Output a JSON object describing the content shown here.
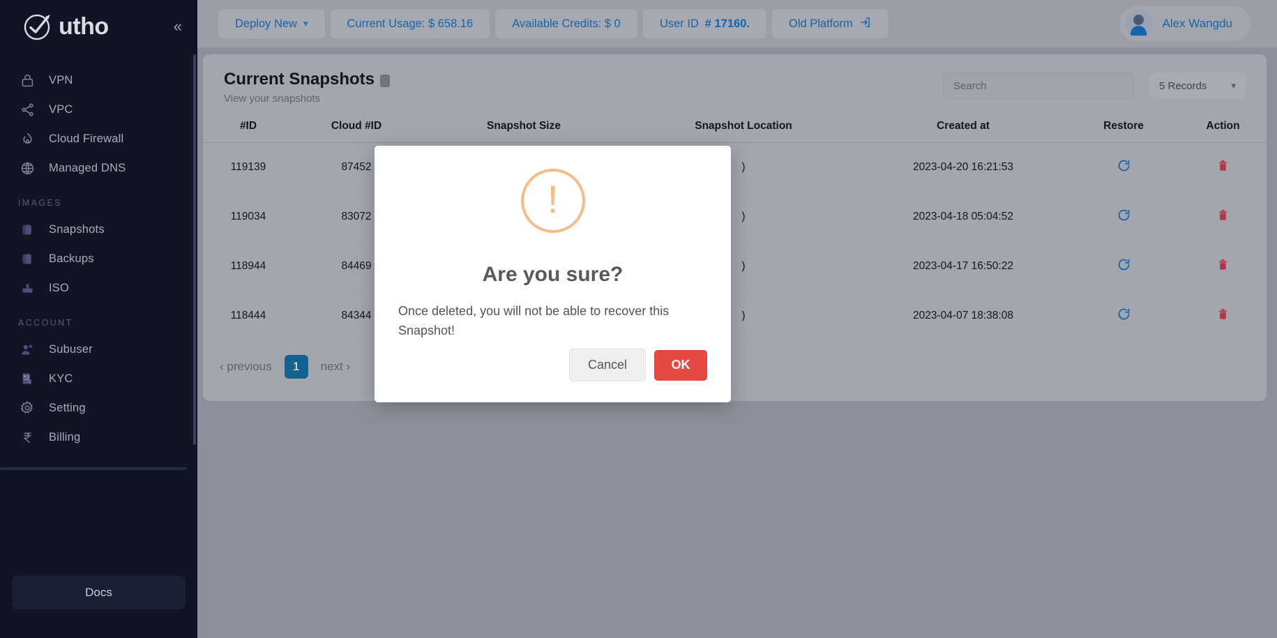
{
  "sidebar": {
    "brand": "utho",
    "collapse_icon": "chevron-double-left-icon",
    "items": [
      {
        "label": "VPN",
        "icon": "lock-icon"
      },
      {
        "label": "VPC",
        "icon": "share-nodes-icon"
      },
      {
        "label": "Cloud Firewall",
        "icon": "flame-icon"
      },
      {
        "label": "Managed DNS",
        "icon": "globe-icon"
      }
    ],
    "sections": [
      {
        "title": "IMAGES",
        "items": [
          {
            "label": "Snapshots",
            "icon": "snapshot-icon"
          },
          {
            "label": "Backups",
            "icon": "backup-icon"
          },
          {
            "label": "ISO",
            "icon": "iso-icon"
          }
        ]
      },
      {
        "title": "ACCOUNT",
        "items": [
          {
            "label": "Subuser",
            "icon": "users-icon"
          },
          {
            "label": "KYC",
            "icon": "id-card-icon"
          },
          {
            "label": "Setting",
            "icon": "gear-icon"
          },
          {
            "label": "Billing",
            "icon": "rupee-icon"
          }
        ]
      }
    ],
    "docs_label": "Docs"
  },
  "topbar": {
    "deploy_new": "Deploy New",
    "current_usage": "Current Usage: $ 658.16",
    "available_credits": "Available Credits: $ 0",
    "user_id": "User ID ",
    "user_id_value": "# 17160.",
    "old_platform": "Old Platform",
    "old_platform_icon": "external-link-icon",
    "user_name": "Alex Wangdu",
    "avatar_icon": "user-avatar-icon"
  },
  "page": {
    "title": "Current Snapshots",
    "subtitle": "View your snapshots",
    "search_placeholder": "Search",
    "search_value": "",
    "records_label": "5 Records",
    "records_chevron": "chevron-down-icon"
  },
  "table": {
    "columns": [
      "#ID",
      "Cloud #ID",
      "Snapshot Size",
      "Snapshot Location",
      "Created at",
      "Restore",
      "Action"
    ],
    "restore_icon": "refresh-circle-icon",
    "delete_icon": "trash-icon",
    "rows": [
      {
        "id": "119139",
        "cloud_id": "87452",
        "size": "",
        "location": ")",
        "created": "2023-04-20 16:21:53"
      },
      {
        "id": "119034",
        "cloud_id": "83072",
        "size": "",
        "location": ")",
        "created": "2023-04-18 05:04:52"
      },
      {
        "id": "118944",
        "cloud_id": "84469",
        "size": "",
        "location": ")",
        "created": "2023-04-17 16:50:22"
      },
      {
        "id": "118444",
        "cloud_id": "84344",
        "size": "",
        "location": ")",
        "created": "2023-04-07 18:38:08"
      }
    ]
  },
  "pagination": {
    "previous": "‹ previous",
    "current_page": "1",
    "next": "next ›"
  },
  "modal": {
    "icon": "warning-exclamation-icon",
    "title": "Are you sure?",
    "message": "Once deleted, you will not be able to recover this Snapshot!",
    "cancel_label": "Cancel",
    "ok_label": "OK"
  },
  "colors": {
    "sidebar_bg": "#111424",
    "accent_blue": "#1565a8",
    "danger_red": "#e64942",
    "warning_orange": "#f8bb86",
    "page_bg": "#8d909a"
  }
}
